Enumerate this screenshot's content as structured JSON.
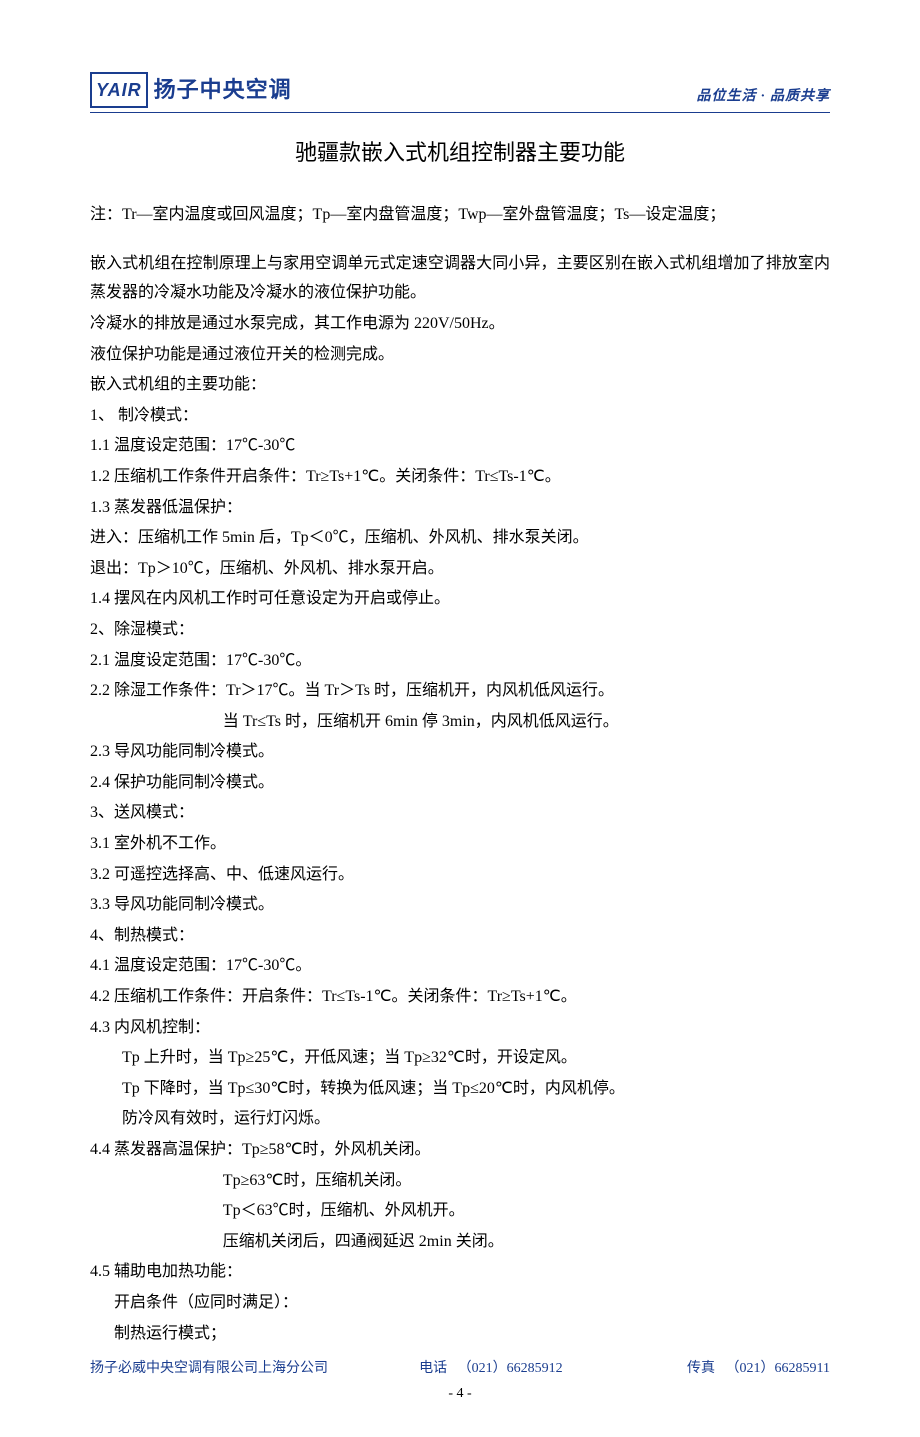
{
  "header": {
    "logo_box": "YAIR",
    "logo_text": "扬子中央空调",
    "tagline": "品位生活 · 品质共享"
  },
  "title": "驰疆款嵌入式机组控制器主要功能",
  "body": {
    "note": "注：Tr—室内温度或回风温度；Tp—室内盘管温度；Twp—室外盘管温度；Ts—设定温度；",
    "intro1": "嵌入式机组在控制原理上与家用空调单元式定速空调器大同小异，主要区别在嵌入式机组增加了排放室内蒸发器的冷凝水功能及冷凝水的液位保护功能。",
    "intro2": "冷凝水的排放是通过水泵完成，其工作电源为 220V/50Hz。",
    "intro3": "液位保护功能是通过液位开关的检测完成。",
    "intro4": "嵌入式机组的主要功能：",
    "l1": "1、 制冷模式：",
    "l1_1": "1.1 温度设定范围：17℃-30℃",
    "l1_2": "1.2 压缩机工作条件开启条件：Tr≥Ts+1℃。关闭条件：Tr≤Ts-1℃。",
    "l1_3": "1.3 蒸发器低温保护：",
    "l1_3a": "进入：压缩机工作 5min 后，Tp＜0℃，压缩机、外风机、排水泵关闭。",
    "l1_3b": "退出：Tp＞10℃，压缩机、外风机、排水泵开启。",
    "l1_4": "1.4 摆风在内风机工作时可任意设定为开启或停止。",
    "l2": "2、除湿模式：",
    "l2_1": "2.1 温度设定范围：17℃-30℃。",
    "l2_2": "2.2 除湿工作条件：Tr＞17℃。当 Tr＞Ts 时，压缩机开，内风机低风运行。",
    "l2_2b": "当 Tr≤Ts 时，压缩机开 6min 停 3min，内风机低风运行。",
    "l2_3": "2.3 导风功能同制冷模式。",
    "l2_4": "2.4 保护功能同制冷模式。",
    "l3": "3、送风模式：",
    "l3_1": "3.1 室外机不工作。",
    "l3_2": "3.2 可遥控选择高、中、低速风运行。",
    "l3_3": "3.3 导风功能同制冷模式。",
    "l4": "4、制热模式：",
    "l4_1": "4.1 温度设定范围：17℃-30℃。",
    "l4_2": "4.2 压缩机工作条件：开启条件：Tr≤Ts-1℃。关闭条件：Tr≥Ts+1℃。",
    "l4_3": "4.3 内风机控制：",
    "l4_3a": "Tp 上升时，当 Tp≥25℃，开低风速；当 Tp≥32℃时，开设定风。",
    "l4_3b": "Tp 下降时，当 Tp≤30℃时，转换为低风速；当 Tp≤20℃时，内风机停。",
    "l4_3c": "防冷风有效时，运行灯闪烁。",
    "l4_4": "4.4 蒸发器高温保护：Tp≥58℃时，外风机关闭。",
    "l4_4b": "Tp≥63℃时，压缩机关闭。",
    "l4_4c": "Tp＜63℃时，压缩机、外风机开。",
    "l4_4d": "压缩机关闭后，四通阀延迟 2min 关闭。",
    "l4_5": "4.5 辅助电加热功能：",
    "l4_5a": "开启条件（应同时满足）：",
    "l4_5b": "制热运行模式；"
  },
  "footer": {
    "company": "扬子必威中央空调有限公司上海分公司",
    "phone_label": "电话",
    "phone": "（021）66285912",
    "fax_label": "传真",
    "fax": "（021）66285911",
    "page": "- 4 -"
  }
}
